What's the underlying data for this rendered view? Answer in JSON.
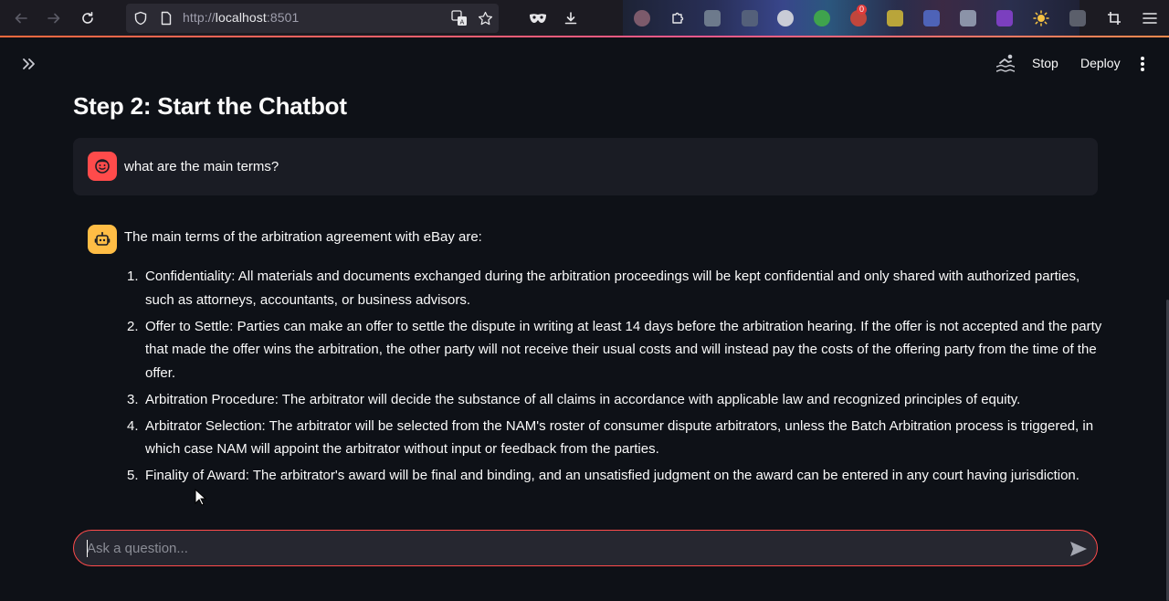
{
  "browser": {
    "url_scheme": "http://",
    "url_host": "localhost",
    "url_port": ":8501",
    "extension_badge": "0"
  },
  "header": {
    "stop_label": "Stop",
    "deploy_label": "Deploy"
  },
  "main": {
    "title": "Step 2: Start the Chatbot",
    "user_message": "what are the main terms?",
    "assistant_intro": "The main terms of the arbitration agreement with eBay are:",
    "assistant_items": [
      {
        "num": "1.",
        "text": "Confidentiality: All materials and documents exchanged during the arbitration proceedings will be kept confidential and only shared with authorized parties, such as attorneys, accountants, or business advisors."
      },
      {
        "num": "2.",
        "text": "Offer to Settle: Parties can make an offer to settle the dispute in writing at least 14 days before the arbitration hearing. If the offer is not accepted and the party that made the offer wins the arbitration, the other party will not receive their usual costs and will instead pay the costs of the offering party from the time of the offer."
      },
      {
        "num": "3.",
        "text": "Arbitration Procedure: The arbitrator will decide the substance of all claims in accordance with applicable law and recognized principles of equity."
      },
      {
        "num": "4.",
        "text": "Arbitrator Selection: The arbitrator will be selected from the NAM's roster of consumer dispute arbitrators, unless the Batch Arbitration process is triggered, in which case NAM will appoint the arbitrator without input or feedback from the parties."
      },
      {
        "num": "5.",
        "text": "Finality of Award: The arbitrator's award will be final and binding, and an unsatisfied judgment on the award can be entered in any court having jurisdiction."
      }
    ]
  },
  "chat_input": {
    "placeholder": "Ask a question...",
    "value": ""
  },
  "colors": {
    "background": "#0e1117",
    "user_avatar": "#ff4b4b",
    "bot_avatar": "#ffbd45",
    "input_border": "#ff4b4b"
  },
  "icons": {
    "back": "arrow-left-icon",
    "forward": "arrow-right-icon",
    "reload": "reload-icon",
    "shield": "shield-icon",
    "page": "page-icon",
    "translate": "translate-icon",
    "bookmark": "star-icon",
    "private": "mask-icon",
    "downloads": "download-icon",
    "app_menu": "hamburger-icon",
    "sidebar": "double-chevron-right-icon",
    "running": "swimmer-icon",
    "more": "kebab-icon",
    "user_avatar": "smiley-face-icon",
    "bot_avatar": "robot-icon",
    "send": "send-icon"
  }
}
